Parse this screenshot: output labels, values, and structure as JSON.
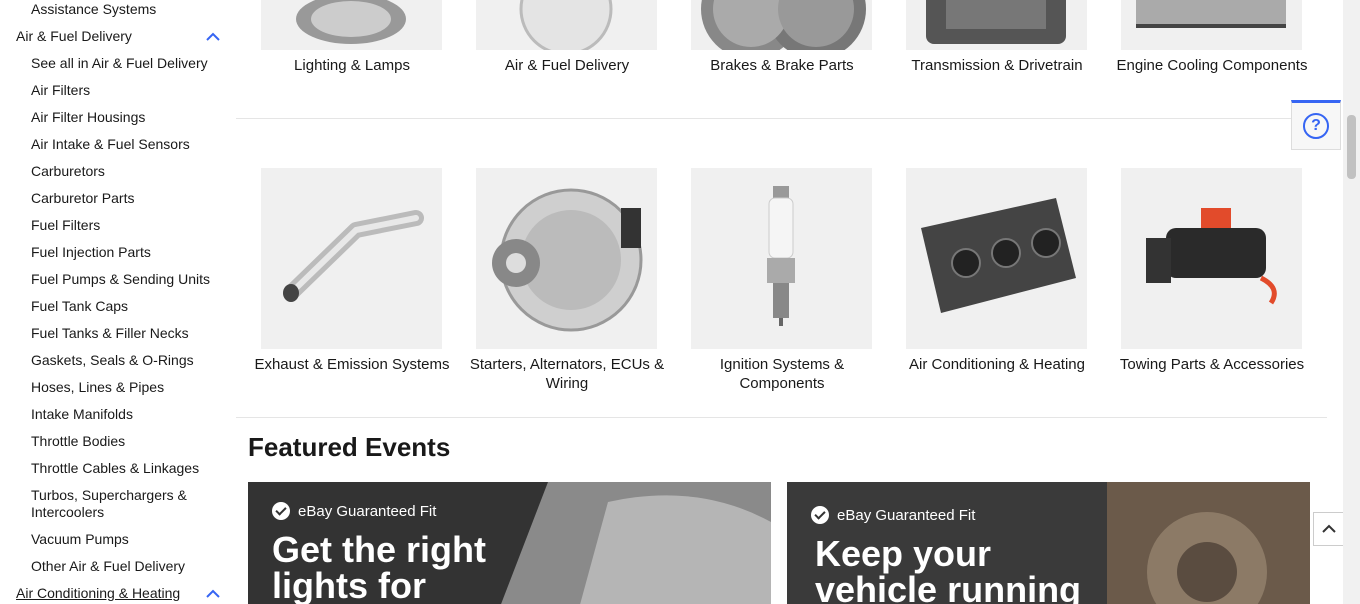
{
  "sidebar": {
    "items": [
      {
        "label": "Assistance Systems",
        "type": "sub"
      },
      {
        "label": "Air & Fuel Delivery",
        "type": "head",
        "expanded": true
      },
      {
        "label": "See all in Air & Fuel Delivery",
        "type": "sub"
      },
      {
        "label": "Air Filters",
        "type": "sub"
      },
      {
        "label": "Air Filter Housings",
        "type": "sub"
      },
      {
        "label": "Air Intake & Fuel Sensors",
        "type": "sub"
      },
      {
        "label": "Carburetors",
        "type": "sub"
      },
      {
        "label": "Carburetor Parts",
        "type": "sub"
      },
      {
        "label": "Fuel Filters",
        "type": "sub"
      },
      {
        "label": "Fuel Injection Parts",
        "type": "sub"
      },
      {
        "label": "Fuel Pumps & Sending Units",
        "type": "sub"
      },
      {
        "label": "Fuel Tank Caps",
        "type": "sub"
      },
      {
        "label": "Fuel Tanks & Filler Necks",
        "type": "sub"
      },
      {
        "label": "Gaskets, Seals & O-Rings",
        "type": "sub"
      },
      {
        "label": "Hoses, Lines & Pipes",
        "type": "sub"
      },
      {
        "label": "Intake Manifolds",
        "type": "sub"
      },
      {
        "label": "Throttle Bodies",
        "type": "sub"
      },
      {
        "label": "Throttle Cables & Linkages",
        "type": "sub"
      },
      {
        "label": "Turbos, Superchargers & Intercoolers",
        "type": "sub"
      },
      {
        "label": "Vacuum Pumps",
        "type": "sub"
      },
      {
        "label": "Other Air & Fuel Delivery",
        "type": "sub"
      },
      {
        "label": "Air Conditioning & Heating",
        "type": "head",
        "expanded": true
      }
    ]
  },
  "categories_row1": [
    {
      "label": "Lighting & Lamps",
      "icon": "headlight-image"
    },
    {
      "label": "Air & Fuel Delivery",
      "icon": "air-fuel-image"
    },
    {
      "label": "Brakes & Brake Parts",
      "icon": "brake-rotor-image"
    },
    {
      "label": "Transmission & Drivetrain",
      "icon": "transmission-image"
    },
    {
      "label": "Engine Cooling Components",
      "icon": "radiator-image"
    }
  ],
  "categories_row2": [
    {
      "label": "Exhaust & Emission Systems",
      "icon": "exhaust-pipe-image"
    },
    {
      "label": "Starters, Alternators, ECUs & Wiring",
      "icon": "alternator-image"
    },
    {
      "label": "Ignition Systems & Components",
      "icon": "spark-plug-image"
    },
    {
      "label": "Air Conditioning & Heating",
      "icon": "climate-control-image"
    },
    {
      "label": "Towing Parts & Accessories",
      "icon": "winch-image"
    }
  ],
  "featured": {
    "title": "Featured Events",
    "banners": [
      {
        "badge": "eBay Guaranteed Fit",
        "headline_1": "Get the right",
        "headline_2": "lights for"
      },
      {
        "badge": "eBay Guaranteed Fit",
        "headline_1": "Keep your",
        "headline_2": "vehicle running"
      }
    ]
  },
  "help": {
    "symbol": "?"
  },
  "colors": {
    "accent": "#3665f3",
    "tile_bg": "#f0f0f0",
    "banner_dark": "#3a3a3a"
  }
}
